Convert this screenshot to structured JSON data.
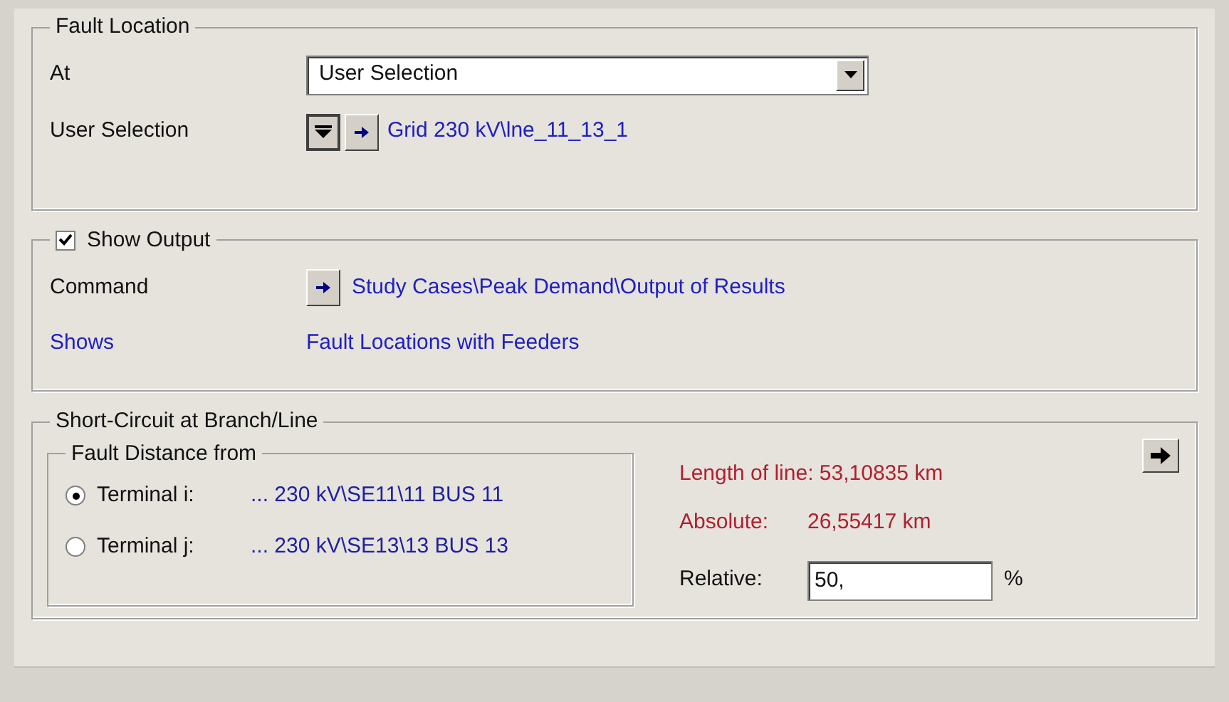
{
  "fault_location": {
    "title": "Fault Location",
    "at_label": "At",
    "at_value": "User Selection",
    "user_selection_label": "User Selection",
    "user_selection_value": "Grid 230 kV\\lne_11_13_1"
  },
  "show_output": {
    "title": "Show Output",
    "checked": true,
    "command_label": "Command",
    "command_value": "Study Cases\\Peak Demand\\Output of Results",
    "shows_label": "Shows",
    "shows_value": "Fault Locations with Feeders"
  },
  "short_circuit": {
    "title": "Short-Circuit at Branch/Line",
    "fault_distance": {
      "title": "Fault Distance from",
      "options": [
        {
          "label": "Terminal i:",
          "value": "... 230 kV\\SE11\\11 BUS 11",
          "selected": true
        },
        {
          "label": "Terminal j:",
          "value": "... 230 kV\\SE13\\13 BUS 13",
          "selected": false
        }
      ]
    },
    "length_of_line": "Length of line: 53,10835 km",
    "absolute_label": "Absolute:",
    "absolute_value": "26,55417 km",
    "relative_label": "Relative:",
    "relative_value": "50,",
    "relative_unit": "%"
  }
}
